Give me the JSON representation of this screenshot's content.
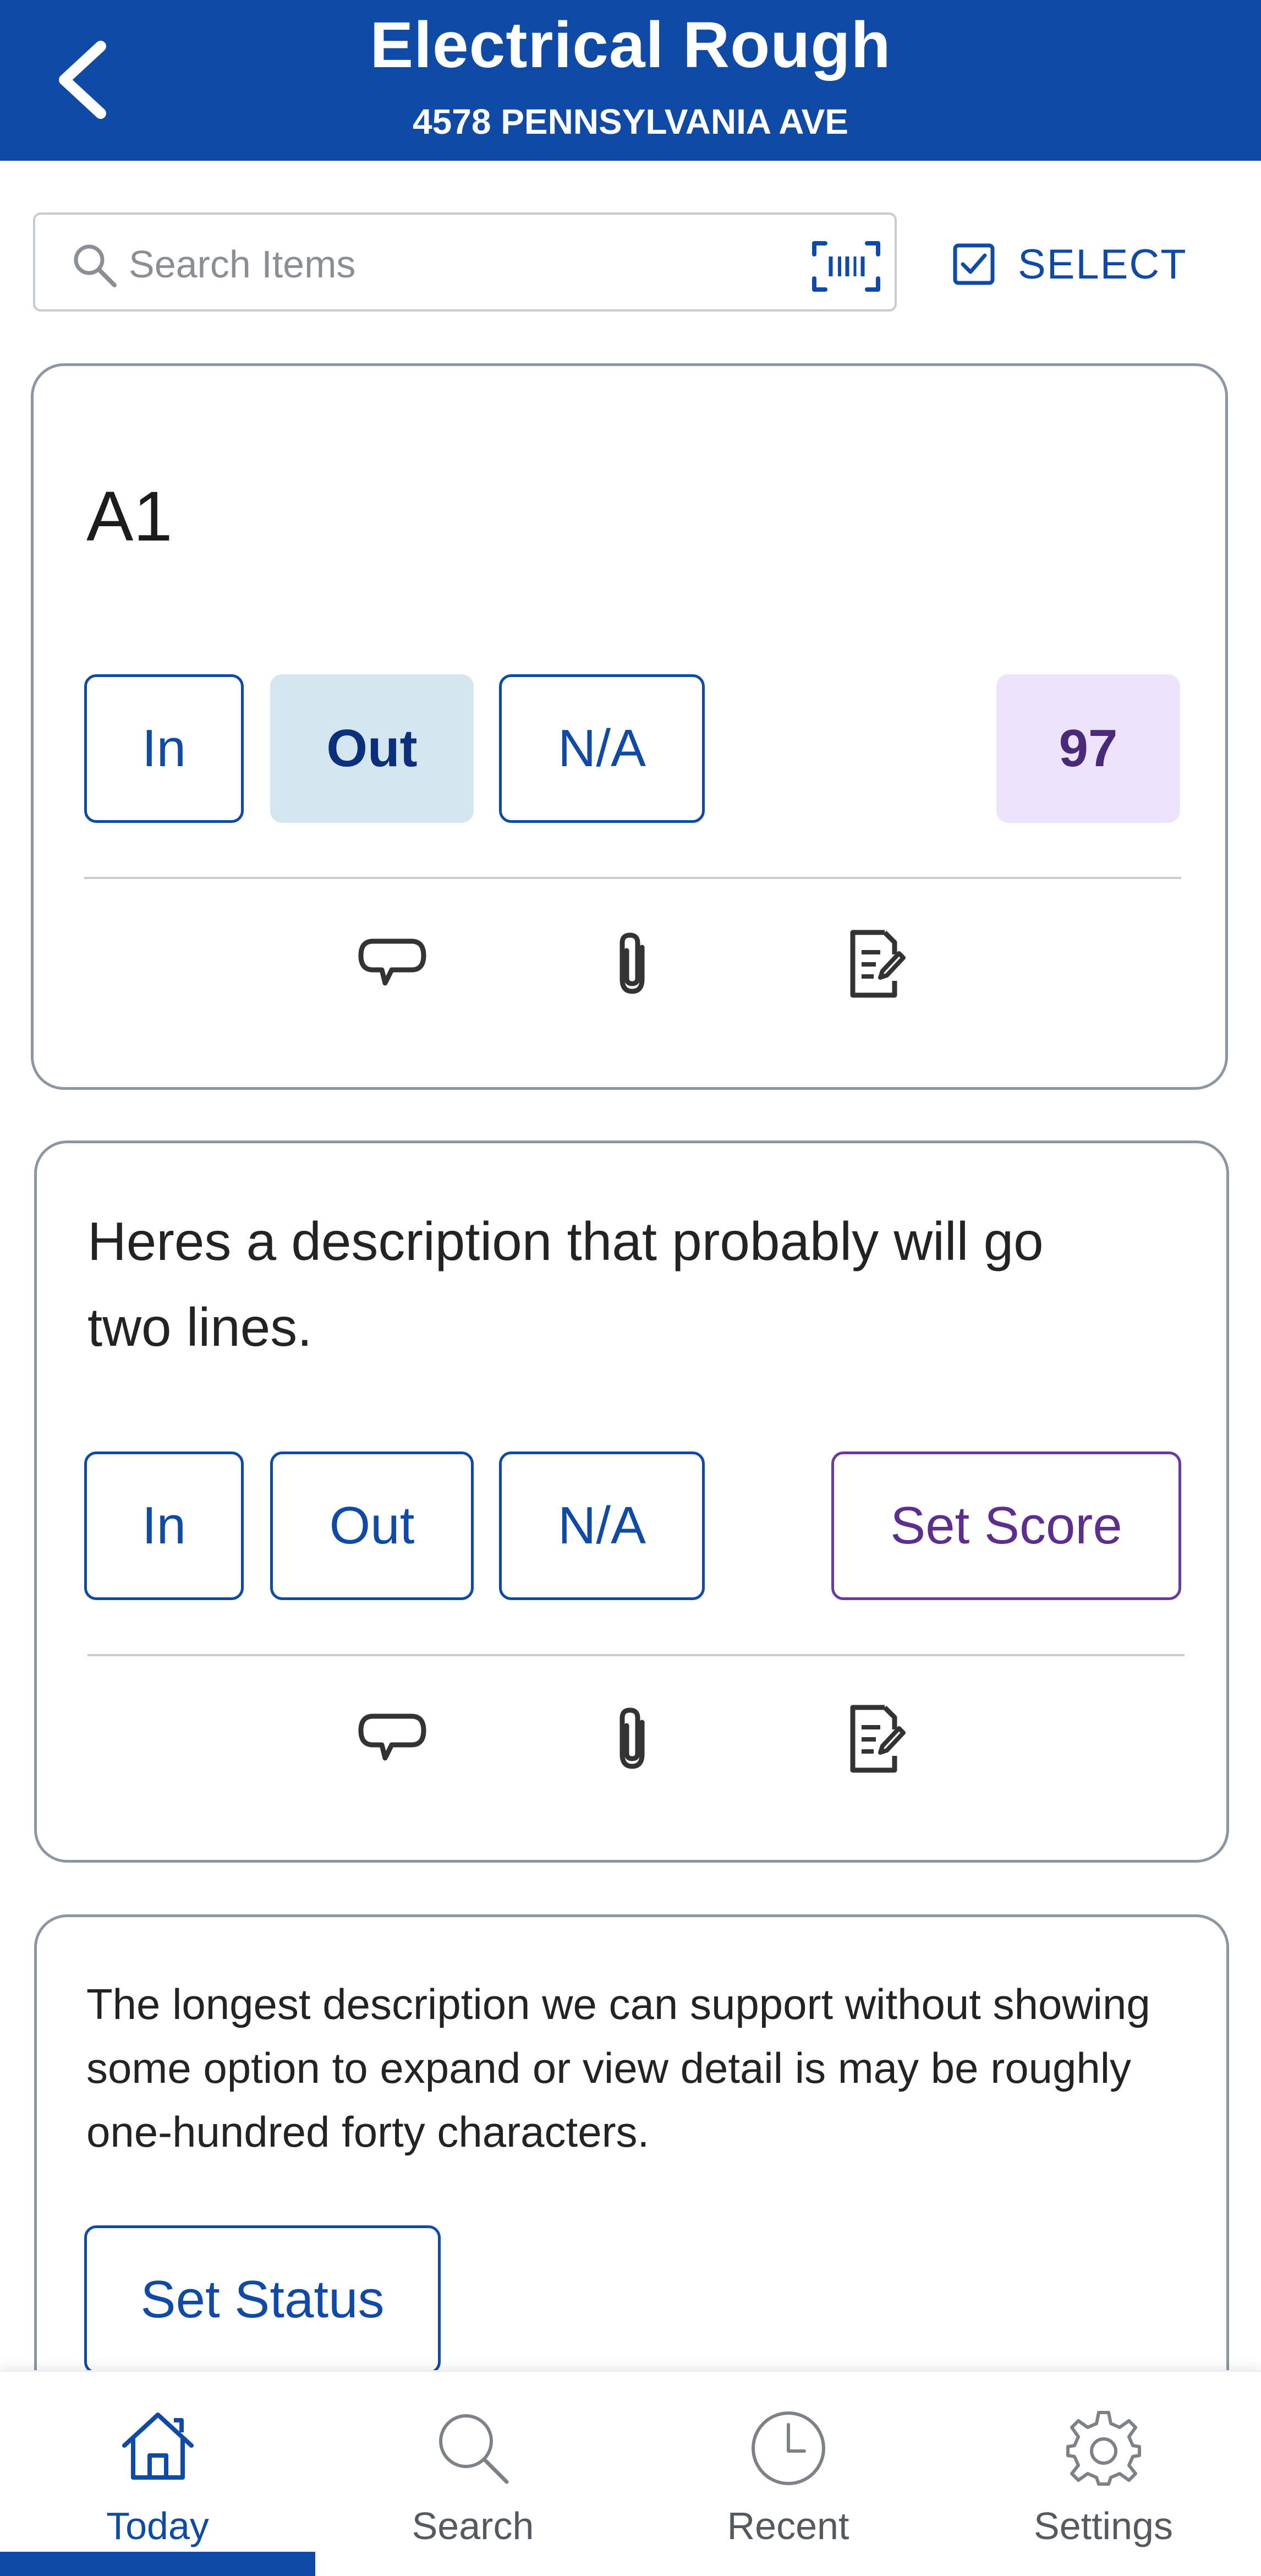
{
  "header": {
    "title": "Electrical Rough",
    "subtitle": "4578 PENNSYLVANIA AVE"
  },
  "search": {
    "placeholder": "Search Items",
    "value": ""
  },
  "toolbar": {
    "select_label": "SELECT"
  },
  "cards": [
    {
      "title": "A1",
      "buttons": {
        "in": "In",
        "out": "Out",
        "na": "N/A"
      },
      "selected": "Out",
      "score": "97",
      "actions": [
        "comment-icon",
        "attachment-icon",
        "note-icon"
      ]
    },
    {
      "description": "Heres a description that probably will go two lines.",
      "buttons": {
        "in": "In",
        "out": "Out",
        "na": "N/A"
      },
      "score_button": "Set Score",
      "actions": [
        "comment-icon",
        "attachment-icon",
        "note-icon"
      ]
    },
    {
      "description": "The longest description we can support without showing some option to expand or view detail is may be roughly one-hundred forty characters.",
      "status_button": "Set Status"
    }
  ],
  "tabs": [
    {
      "label": "Today",
      "icon": "home-icon",
      "active": true
    },
    {
      "label": "Search",
      "icon": "search-icon",
      "active": false
    },
    {
      "label": "Recent",
      "icon": "clock-icon",
      "active": false
    },
    {
      "label": "Settings",
      "icon": "gear-icon",
      "active": false
    }
  ],
  "colors": {
    "brand": "#0f4aa6",
    "selected_bg": "#d4e7f0",
    "score_bg": "#ede3fb",
    "score_accent": "#6a3aa0"
  }
}
